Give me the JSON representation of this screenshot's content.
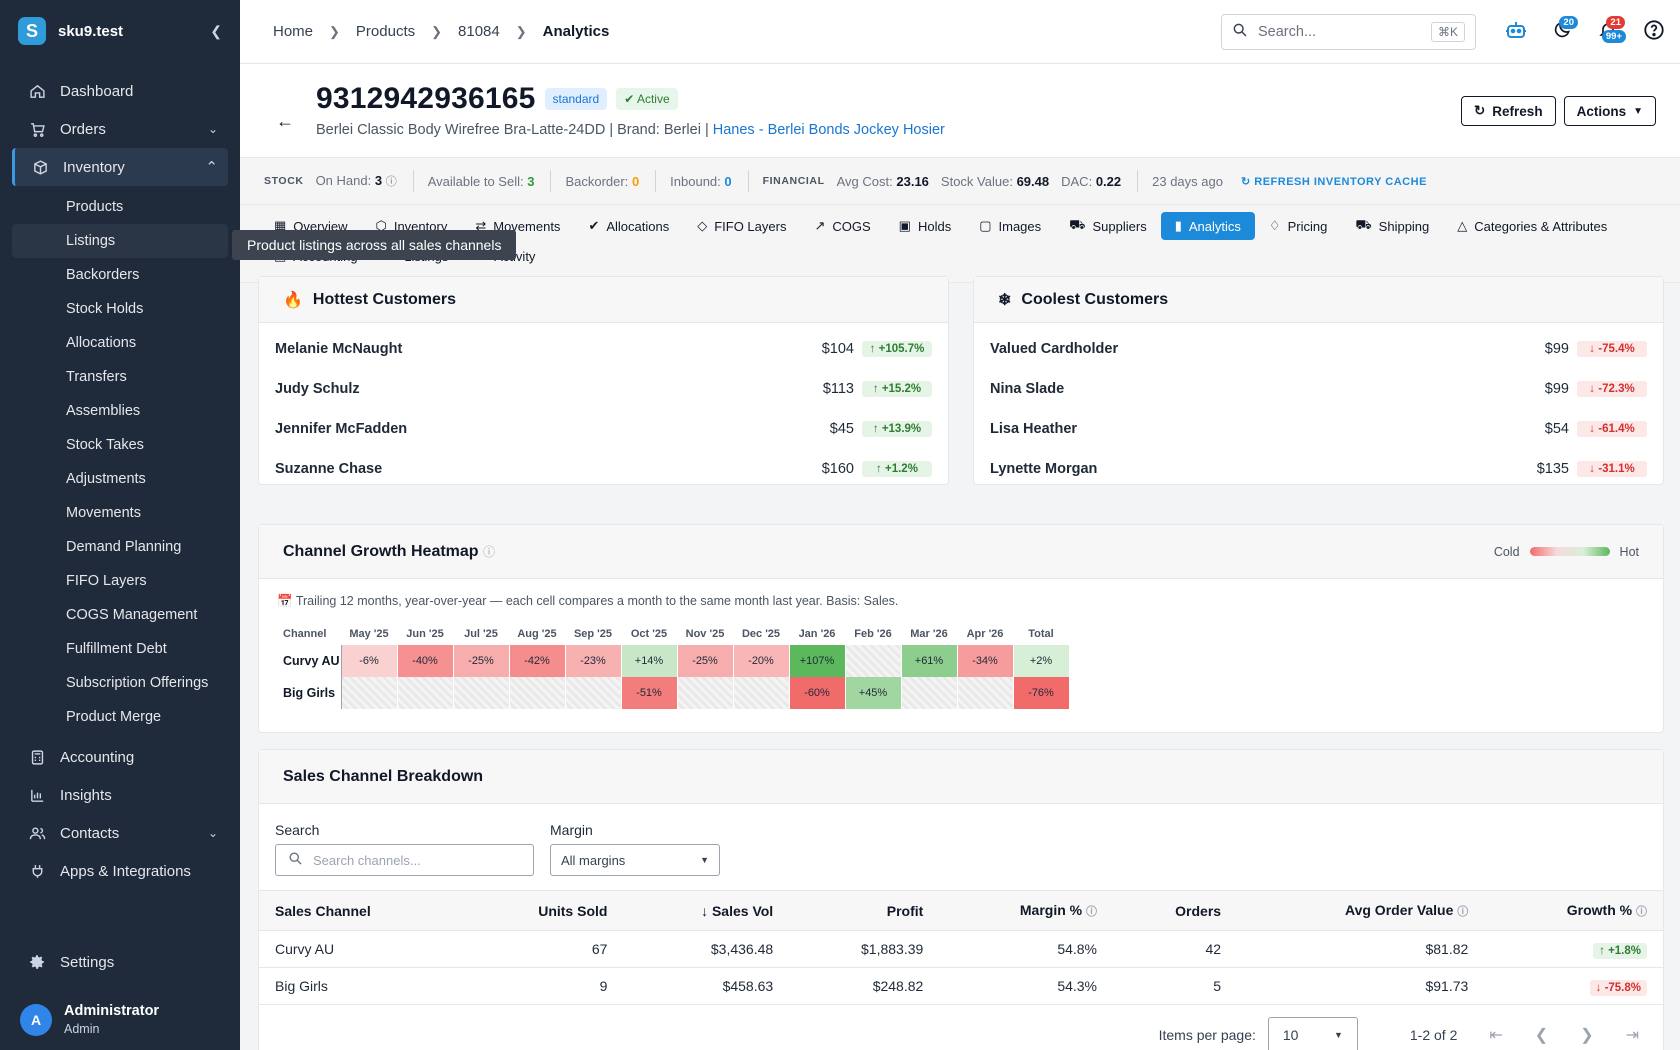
{
  "sidebar": {
    "brand": "sku9.test",
    "items": [
      {
        "label": "Dashboard",
        "icon": "home-icon"
      },
      {
        "label": "Orders",
        "icon": "cart-icon"
      },
      {
        "label": "Inventory",
        "icon": "box-icon"
      }
    ],
    "inventory_sub": [
      "Products",
      "Listings",
      "Backorders",
      "Stock Holds",
      "Allocations",
      "Transfers",
      "Assemblies",
      "Stock Takes",
      "Adjustments",
      "Movements",
      "Demand Planning",
      "FIFO Layers",
      "COGS Management",
      "Fulfillment Debt",
      "Subscription Offerings",
      "Product Merge"
    ],
    "items2": [
      {
        "label": "Accounting",
        "icon": "calculator-icon"
      },
      {
        "label": "Insights",
        "icon": "bar-chart-icon"
      },
      {
        "label": "Contacts",
        "icon": "people-icon"
      },
      {
        "label": "Apps & Integrations",
        "icon": "plug-icon"
      }
    ],
    "settings": "Settings",
    "user": {
      "initial": "A",
      "name": "Administrator",
      "role": "Admin"
    }
  },
  "tooltip": "Product listings across all sales channels",
  "topbar": {
    "breadcrumbs": [
      "Home",
      "Products",
      "81084",
      "Analytics"
    ],
    "search_placeholder": "Search...",
    "search_kbd": "⌘K",
    "badges": {
      "moon": "20",
      "notif_a": "21",
      "notif_b": "99+"
    }
  },
  "header": {
    "sku": "9312942936165",
    "type_pill": "standard",
    "status_pill": "Active",
    "desc": "Berlei Classic Body Wirefree Bra-Latte-24DD | Brand: Berlei | ",
    "supplier_link": "Hanes - Berlei Bonds Jockey Hosier",
    "refresh_btn": "Refresh",
    "actions_btn": "Actions"
  },
  "stock": {
    "stock_label": "STOCK",
    "on_hand_label": "On Hand:",
    "on_hand": "3",
    "available_label": "Available to Sell:",
    "available": "3",
    "backorder_label": "Backorder:",
    "backorder": "0",
    "inbound_label": "Inbound:",
    "inbound": "0",
    "financial_label": "FINANCIAL",
    "avg_cost_label": "Avg Cost:",
    "avg_cost": "23.16",
    "stock_value_label": "Stock Value:",
    "stock_value": "69.48",
    "dac_label": "DAC:",
    "dac": "0.22",
    "updated": "23 days ago",
    "refresh_cache": "REFRESH INVENTORY CACHE"
  },
  "tabs": {
    "row1": [
      {
        "label": "Overview",
        "icon": "grid-icon"
      },
      {
        "label": "Inventory",
        "icon": "cube-icon"
      },
      {
        "label": "Movements",
        "icon": "arrows-icon"
      },
      {
        "label": "Allocations",
        "icon": "check-badge-icon"
      },
      {
        "label": "FIFO Layers",
        "icon": "layers-icon"
      },
      {
        "label": "COGS",
        "icon": "line-chart-icon"
      },
      {
        "label": "Holds",
        "icon": "lock-icon"
      },
      {
        "label": "Images",
        "icon": "image-icon"
      },
      {
        "label": "Suppliers",
        "icon": "truck-icon"
      },
      {
        "label": "Analytics",
        "icon": "bar-chart-icon",
        "active": true
      },
      {
        "label": "Pricing",
        "icon": "tag-icon"
      },
      {
        "label": "Shipping",
        "icon": "shipping-icon"
      },
      {
        "label": "Categories & Attributes",
        "icon": "shapes-icon"
      }
    ],
    "row2": [
      {
        "label": "Accounting",
        "icon": "receipt-icon"
      },
      {
        "label": "Listings",
        "icon": "list-icon"
      },
      {
        "label": "Activity",
        "icon": "history-icon"
      }
    ]
  },
  "hottest": {
    "title": "Hottest Customers",
    "rows": [
      {
        "name": "Melanie McNaught",
        "amount": "$104",
        "change": "+105.7%"
      },
      {
        "name": "Judy Schulz",
        "amount": "$113",
        "change": "+15.2%"
      },
      {
        "name": "Jennifer McFadden",
        "amount": "$45",
        "change": "+13.9%"
      },
      {
        "name": "Suzanne Chase",
        "amount": "$160",
        "change": "+1.2%"
      }
    ]
  },
  "coolest": {
    "title": "Coolest Customers",
    "rows": [
      {
        "name": "Valued Cardholder",
        "amount": "$99",
        "change": "-75.4%"
      },
      {
        "name": "Nina Slade",
        "amount": "$99",
        "change": "-72.3%"
      },
      {
        "name": "Lisa Heather",
        "amount": "$54",
        "change": "-61.4%"
      },
      {
        "name": "Lynette Morgan",
        "amount": "$135",
        "change": "-31.1%"
      }
    ]
  },
  "heatmap": {
    "title": "Channel Growth Heatmap",
    "legend_cold": "Cold",
    "legend_hot": "Hot",
    "note": "Trailing 12 months, year-over-year — each cell compares a month to the same month last year. Basis: Sales.",
    "channel_header": "Channel",
    "months": [
      "May '25",
      "Jun '25",
      "Jul '25",
      "Aug '25",
      "Sep '25",
      "Oct '25",
      "Nov '25",
      "Dec '25",
      "Jan '26",
      "Feb '26",
      "Mar '26",
      "Apr '26"
    ],
    "total_header": "Total",
    "rows": [
      {
        "channel": "Curvy AU",
        "cells": [
          -6,
          -40,
          -25,
          -42,
          -23,
          14,
          -25,
          -20,
          107,
          null,
          61,
          -34
        ],
        "total": 2
      },
      {
        "channel": "Big Girls",
        "cells": [
          null,
          null,
          null,
          null,
          null,
          -51,
          null,
          null,
          -60,
          45,
          null,
          null
        ],
        "total": -76
      }
    ],
    "colors": {
      "cold": "#f26b6b",
      "hot": "#5cb85c"
    }
  },
  "breakdown": {
    "title": "Sales Channel Breakdown",
    "search_label": "Search",
    "search_placeholder": "Search channels...",
    "margin_label": "Margin",
    "margin_value": "All margins",
    "columns": [
      "Sales Channel",
      "Units Sold",
      "Sales Vol",
      "Profit",
      "Margin %",
      "Orders",
      "Avg Order Value",
      "Growth %"
    ],
    "rows": [
      {
        "channel": "Curvy AU",
        "units": "67",
        "sales": "$3,436.48",
        "profit": "$1,883.39",
        "margin": "54.8%",
        "orders": "42",
        "aov": "$81.82",
        "growth": "+1.8%"
      },
      {
        "channel": "Big Girls",
        "units": "9",
        "sales": "$458.63",
        "profit": "$248.82",
        "margin": "54.3%",
        "orders": "5",
        "aov": "$91.73",
        "growth": "-75.8%"
      }
    ],
    "items_per_page_label": "Items per page:",
    "items_per_page": "10",
    "range": "1-2 of 2"
  }
}
